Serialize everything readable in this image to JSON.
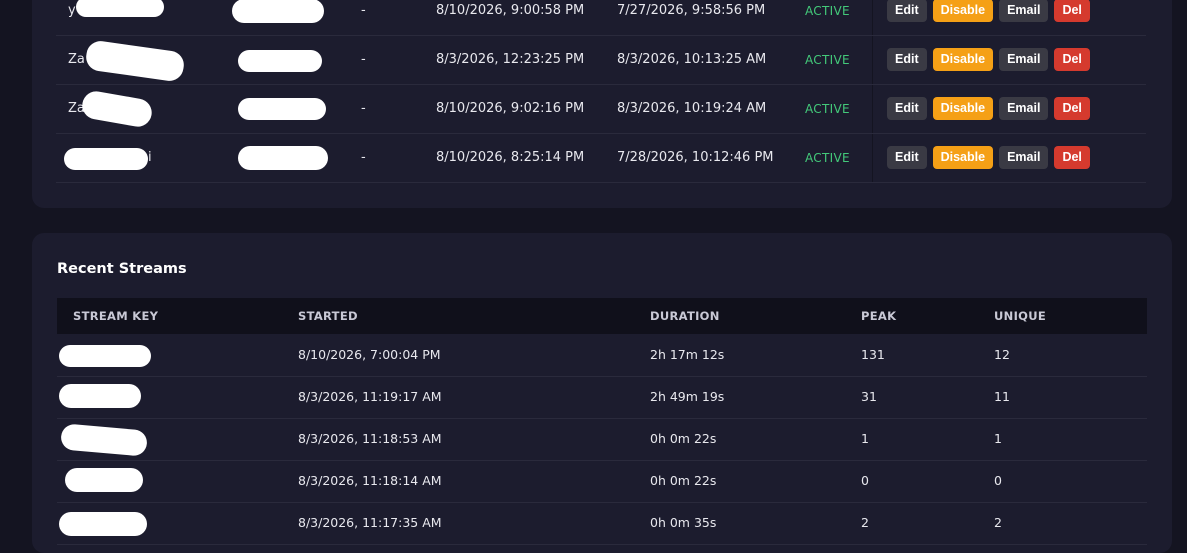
{
  "users": {
    "rows": [
      {
        "name_visible": "y",
        "dash": "-",
        "last_login": "8/10/2026, 9:00:58 PM",
        "created": "7/27/2026, 9:58:56 PM",
        "status": "ACTIVE"
      },
      {
        "name_visible": "Za",
        "dash": "-",
        "last_login": "8/3/2026, 12:23:25 PM",
        "created": "8/3/2026, 10:13:25 AM",
        "status": "ACTIVE"
      },
      {
        "name_visible": "Za",
        "dash": "-",
        "last_login": "8/10/2026, 9:02:16 PM",
        "created": "8/3/2026, 10:19:24 AM",
        "status": "ACTIVE"
      },
      {
        "name_visible": "i",
        "dash": "-",
        "last_login": "8/10/2026, 8:25:14 PM",
        "created": "7/28/2026, 10:12:46 PM",
        "status": "ACTIVE"
      }
    ],
    "actions": {
      "edit": "Edit",
      "disable": "Disable",
      "email": "Email",
      "del": "Del"
    },
    "colors": {
      "active": "#43c97a",
      "disable": "#f5a016",
      "del": "#d53a2e",
      "neutral": "#3a3a44"
    }
  },
  "streams": {
    "title": "Recent Streams",
    "columns": [
      "STREAM KEY",
      "STARTED",
      "DURATION",
      "PEAK",
      "UNIQUE"
    ],
    "rows": [
      {
        "started": "8/10/2026, 7:00:04 PM",
        "duration": "2h 17m 12s",
        "peak": "131",
        "unique": "12"
      },
      {
        "started": "8/3/2026, 11:19:17 AM",
        "duration": "2h 49m 19s",
        "peak": "31",
        "unique": "11"
      },
      {
        "started": "8/3/2026, 11:18:53 AM",
        "duration": "0h 0m 22s",
        "peak": "1",
        "unique": "1"
      },
      {
        "started": "8/3/2026, 11:18:14 AM",
        "duration": "0h 0m 22s",
        "peak": "0",
        "unique": "0"
      },
      {
        "started": "8/3/2026, 11:17:35 AM",
        "duration": "0h 0m 35s",
        "peak": "2",
        "unique": "2"
      }
    ]
  }
}
